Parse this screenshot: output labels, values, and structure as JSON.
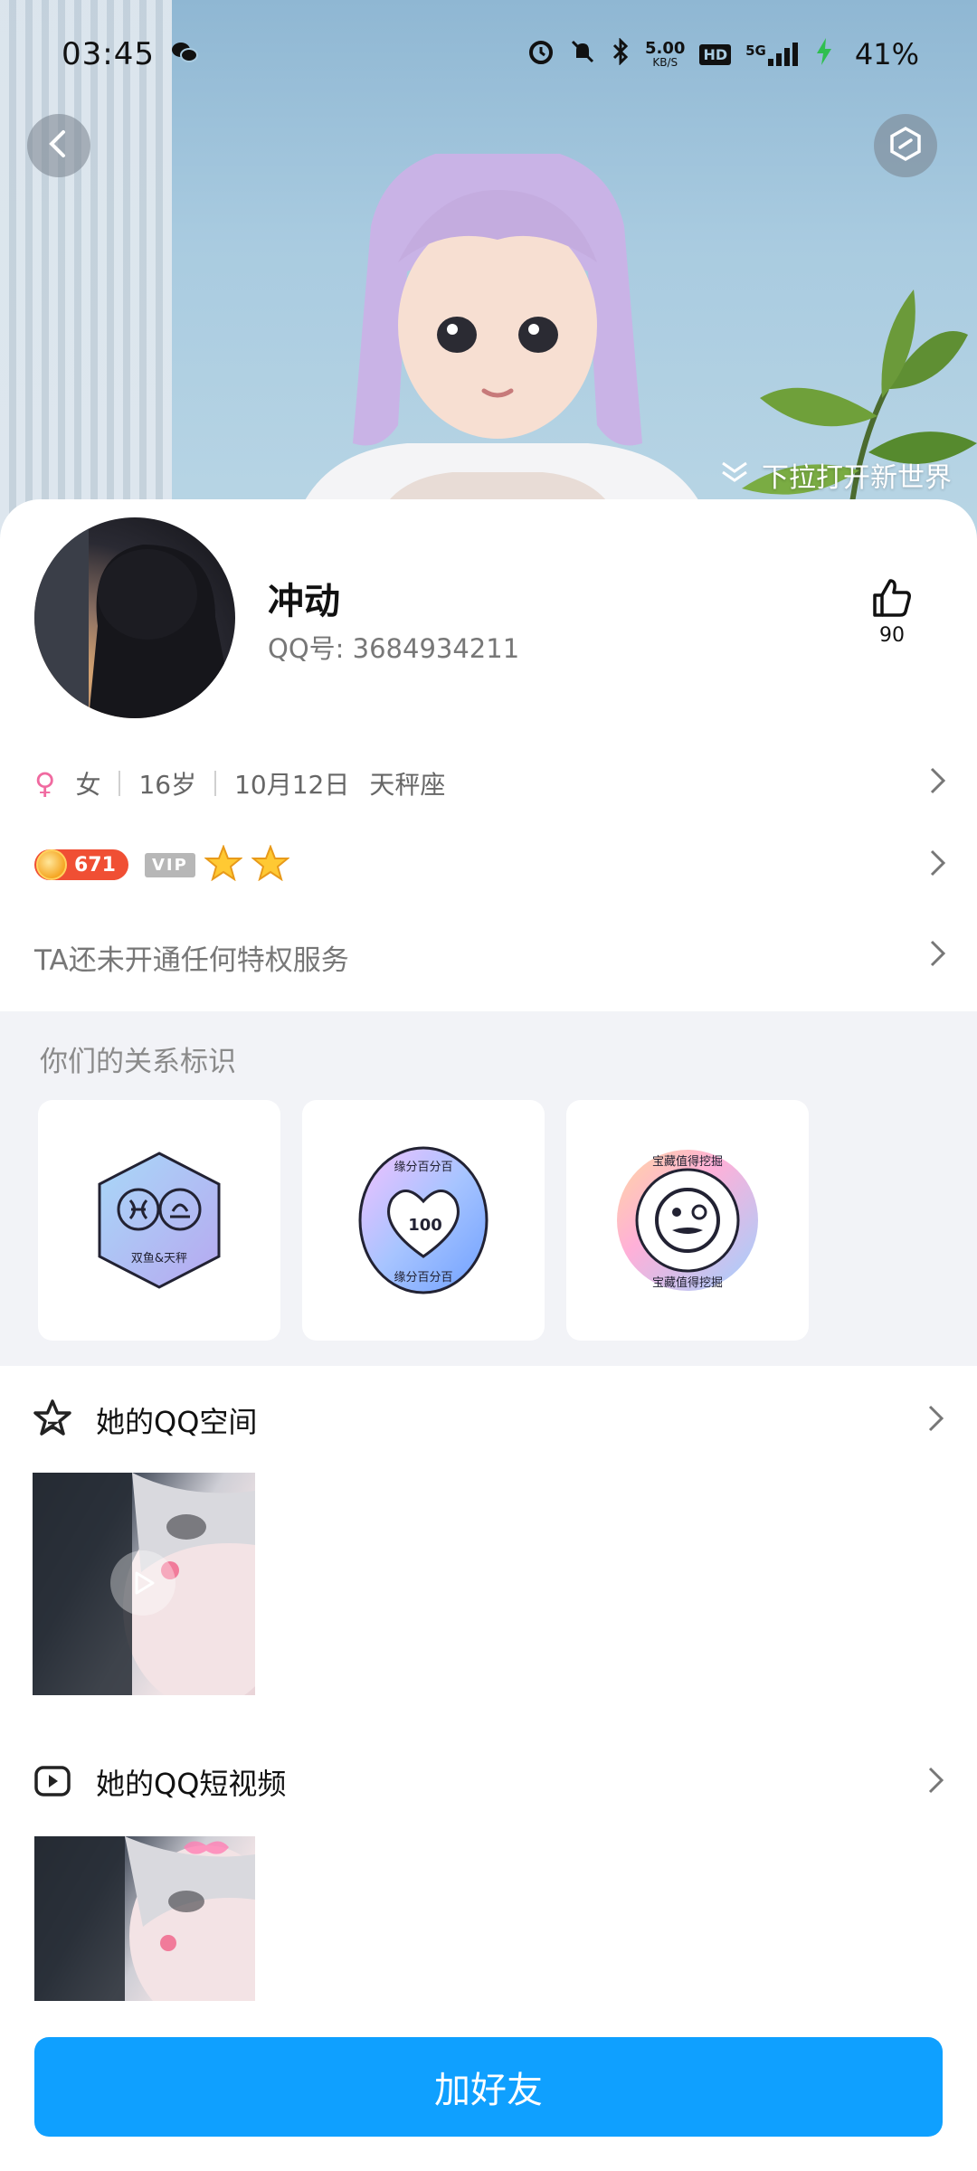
{
  "status_bar": {
    "time": "03:45",
    "net_speed": "5.00",
    "net_unit": "KB/S",
    "hd": "HD",
    "network": "5G",
    "battery": "41%"
  },
  "header": {
    "pull_hint": "下拉打开新世界"
  },
  "profile": {
    "name": "冲动",
    "qq_label": "QQ号: 3684934211",
    "likes": "90"
  },
  "basic_info": {
    "gender": "女",
    "age": "16岁",
    "birthday": "10月12日",
    "zodiac": "天秤座"
  },
  "badges": {
    "level": "671",
    "vip": "VIP"
  },
  "privilege_text": "TA还未开通任何特权服务",
  "relation": {
    "title": "你们的关系标识",
    "cards": [
      {
        "caption": "双鱼&天秤"
      },
      {
        "caption": "缘分百分百",
        "number": "100"
      },
      {
        "caption": "宝藏值得挖掘"
      }
    ]
  },
  "qzone": {
    "label": "她的QQ空间"
  },
  "shortvideo": {
    "label": "她的QQ短视频"
  },
  "cta": {
    "add_friend": "加好友"
  },
  "colors": {
    "primary_button": "#0fa0ff",
    "female_icon": "#f06aa0",
    "level_badge": "#f04f34"
  }
}
